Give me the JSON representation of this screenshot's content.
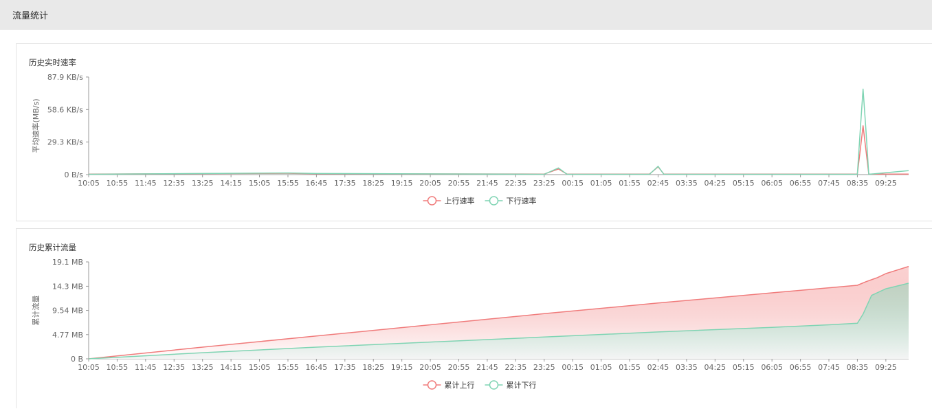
{
  "page": {
    "title": "流量统计"
  },
  "colors": {
    "up": "#f07b7b",
    "down": "#7fd4b3",
    "axis": "#999999",
    "text": "#666666"
  },
  "chart_data": [
    {
      "type": "line",
      "title": "历史实时速率",
      "ylabel": "平均速率(MB/s)",
      "ylim": [
        0,
        87.9
      ],
      "yticks": [
        "0 B/s",
        "29.3 KB/s",
        "58.6 KB/s",
        "87.9 KB/s"
      ],
      "ytick_values": [
        0,
        29.3,
        58.6,
        87.9
      ],
      "xticks": [
        "10:05",
        "10:55",
        "11:45",
        "12:35",
        "13:25",
        "14:15",
        "15:05",
        "15:55",
        "16:45",
        "17:35",
        "18:25",
        "19:15",
        "20:05",
        "20:55",
        "21:45",
        "22:35",
        "23:25",
        "00:15",
        "01:05",
        "01:55",
        "02:45",
        "03:35",
        "04:25",
        "05:15",
        "06:05",
        "06:55",
        "07:45",
        "08:35",
        "09:25"
      ],
      "legend": [
        "上行速率",
        "下行速率"
      ],
      "legend_position": "bottom-center",
      "series": [
        {
          "name": "上行速率",
          "color": "#f07b7b",
          "x": [
            "10:05",
            "15:55",
            "16:45",
            "23:25",
            "23:50",
            "00:05",
            "02:30",
            "02:45",
            "02:55",
            "08:35",
            "08:40",
            "08:45",
            "08:50",
            "08:55",
            "10:30"
          ],
          "values": [
            0.5,
            1.2,
            0.8,
            0.5,
            5.0,
            0.5,
            0.5,
            7.0,
            0.5,
            0.5,
            22.0,
            44.0,
            22.0,
            0.5,
            0.5
          ]
        },
        {
          "name": "下行速率",
          "color": "#7fd4b3",
          "x": [
            "10:05",
            "15:55",
            "16:45",
            "23:25",
            "23:50",
            "00:05",
            "02:30",
            "02:45",
            "02:55",
            "08:35",
            "08:40",
            "08:45",
            "08:50",
            "08:55",
            "10:30"
          ],
          "values": [
            0.3,
            1.5,
            1.0,
            0.3,
            6.0,
            0.3,
            0.3,
            7.5,
            0.3,
            0.3,
            40.0,
            77.0,
            40.0,
            0.3,
            3.5
          ]
        }
      ]
    },
    {
      "type": "area",
      "title": "历史累计流量",
      "ylabel": "累计流量",
      "ylim": [
        0,
        19.1
      ],
      "yticks": [
        "0 B",
        "4.77 MB",
        "9.54 MB",
        "14.3 MB",
        "19.1 MB"
      ],
      "ytick_values": [
        0,
        4.77,
        9.54,
        14.3,
        19.1
      ],
      "xticks": [
        "10:05",
        "10:55",
        "11:45",
        "12:35",
        "13:25",
        "14:15",
        "15:05",
        "15:55",
        "16:45",
        "17:35",
        "18:25",
        "19:15",
        "20:05",
        "20:55",
        "21:45",
        "22:35",
        "23:25",
        "00:15",
        "01:05",
        "01:55",
        "02:45",
        "03:35",
        "04:25",
        "05:15",
        "06:05",
        "06:55",
        "07:45",
        "08:35",
        "09:25"
      ],
      "legend": [
        "累计上行",
        "累计下行"
      ],
      "legend_position": "bottom-center",
      "series": [
        {
          "name": "累计上行",
          "color": "#f07b7b",
          "x": [
            "10:05",
            "13:25",
            "16:45",
            "20:05",
            "23:25",
            "02:45",
            "06:05",
            "08:35",
            "08:50",
            "09:10",
            "09:25",
            "09:45",
            "10:05"
          ],
          "values": [
            0,
            2.3,
            4.5,
            6.7,
            8.9,
            11.0,
            13.0,
            14.5,
            15.2,
            16.0,
            16.8,
            17.5,
            18.2
          ]
        },
        {
          "name": "累计下行",
          "color": "#7fd4b3",
          "x": [
            "10:05",
            "13:25",
            "16:45",
            "20:05",
            "23:25",
            "02:45",
            "06:05",
            "07:45",
            "08:35",
            "08:45",
            "09:00",
            "09:25",
            "10:05"
          ],
          "values": [
            0,
            1.2,
            2.3,
            3.3,
            4.3,
            5.3,
            6.2,
            6.7,
            7.0,
            8.8,
            12.5,
            13.8,
            14.9
          ]
        }
      ]
    }
  ]
}
